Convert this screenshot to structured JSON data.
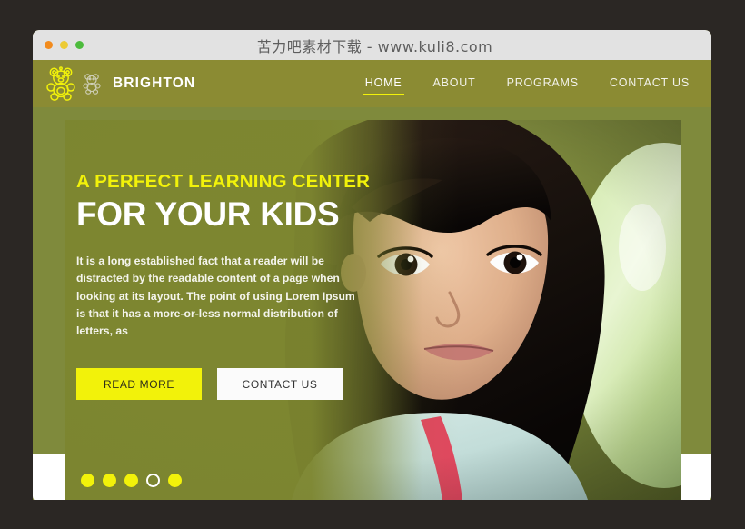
{
  "window": {
    "title": "苦力吧素材下载 - www.kuli8.com",
    "traffic_lights": [
      {
        "name": "close",
        "color": "#f28b1d"
      },
      {
        "name": "minimize",
        "color": "#eccb35"
      },
      {
        "name": "zoom",
        "color": "#4cbb3c"
      }
    ]
  },
  "header": {
    "brand_name": "BRIGHTON",
    "logo_icon": "teddy-bear-icon",
    "nav": [
      {
        "label": "HOME",
        "active": true
      },
      {
        "label": "ABOUT",
        "active": false
      },
      {
        "label": "PROGRAMS",
        "active": false
      },
      {
        "label": "CONTACT US",
        "active": false
      }
    ]
  },
  "hero": {
    "eyebrow": "A PERFECT LEARNING CENTER",
    "title": "FOR YOUR KIDS",
    "description": "It is a long established fact that a reader will be distracted by the readable content of a page when looking at its layout. The point of using Lorem Ipsum is that it has a more-or-less normal distribution of letters, as",
    "primary_button": "READ MORE",
    "secondary_button": "CONTACT US",
    "image_alt": "young girl portrait with green balloon",
    "carousel_dots": [
      {
        "state": "filled"
      },
      {
        "state": "filled"
      },
      {
        "state": "filled"
      },
      {
        "state": "ring"
      },
      {
        "state": "filled"
      }
    ]
  },
  "colors": {
    "page_background": "#2b2724",
    "titlebar": "#e2e2e2",
    "header_olive": "#8b8b33",
    "body_olive": "#7f8a3c",
    "accent_yellow": "#f2f20a",
    "text_white": "#ffffff"
  }
}
